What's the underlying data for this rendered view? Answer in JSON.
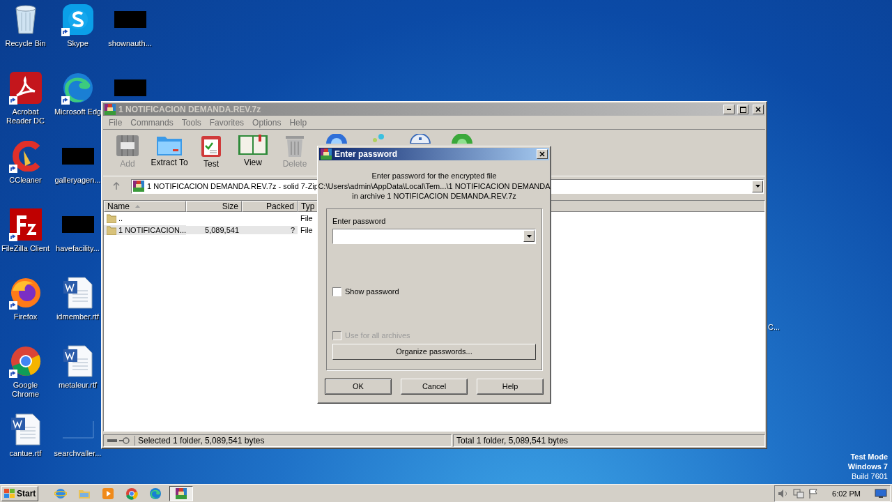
{
  "desktop": {
    "icons": [
      {
        "kind": "recycle",
        "label": "Recycle Bin"
      },
      {
        "kind": "acrobat",
        "label": "Acrobat Reader DC",
        "shortcut": true
      },
      {
        "kind": "ccleaner",
        "label": "CCleaner",
        "shortcut": true
      },
      {
        "kind": "filezilla",
        "label": "FileZilla Client",
        "shortcut": true
      },
      {
        "kind": "firefox",
        "label": "Firefox",
        "shortcut": true
      },
      {
        "kind": "chrome",
        "label": "Google Chrome",
        "shortcut": true
      },
      {
        "kind": "word",
        "label": "cantue.rtf"
      },
      {
        "kind": "skype",
        "label": "Skype",
        "shortcut": true
      },
      {
        "kind": "edge",
        "label": "Microsoft Edg",
        "shortcut": true
      },
      {
        "kind": "redacted",
        "label": "galleryagen..."
      },
      {
        "kind": "redacted",
        "label": "havefacility..."
      },
      {
        "kind": "word",
        "label": "idmember.rtf"
      },
      {
        "kind": "word",
        "label": "metaleur.rtf"
      },
      {
        "kind": "blank",
        "label": "searchvaller..."
      },
      {
        "kind": "redacted",
        "label": "shownauth..."
      },
      {
        "kind": "redacted"
      }
    ],
    "stray_label": "C...",
    "system_text": [
      "Test Mode",
      "Windows 7",
      "Build 7601"
    ]
  },
  "window": {
    "title": "1 NOTIFICACION DEMANDA.REV.7z",
    "menu": [
      "File",
      "Commands",
      "Tools",
      "Favorites",
      "Options",
      "Help"
    ],
    "toolbar": [
      {
        "kind": "add",
        "label": "Add",
        "disabled": true
      },
      {
        "kind": "extract",
        "label": "Extract To",
        "disabled": false
      },
      {
        "kind": "test",
        "label": "Test",
        "disabled": false
      },
      {
        "kind": "view",
        "label": "View",
        "disabled": false
      },
      {
        "kind": "delete",
        "label": "Delete",
        "disabled": true
      },
      {
        "kind": "find"
      },
      {
        "kind": "wizard"
      },
      {
        "kind": "info"
      },
      {
        "kind": "virus"
      }
    ],
    "address": "1 NOTIFICACION DEMANDA.REV.7z - solid 7-Zip",
    "columns": [
      "Name",
      "Size",
      "Packed",
      "Typ"
    ],
    "rows": [
      {
        "name": "..",
        "size": "",
        "packed": "",
        "type": "File",
        "selected": false
      },
      {
        "name": "1 NOTIFICACION...",
        "size": "5,089,541",
        "packed": "?",
        "type": "File",
        "selected": true
      }
    ],
    "status": [
      "Selected 1 folder, 5,089,541 bytes",
      "Total 1 folder, 5,089,541 bytes"
    ]
  },
  "dialog": {
    "title": "Enter password",
    "message": [
      "Enter password for the encrypted file",
      "C:\\Users\\admin\\AppData\\Local\\Tem...\\1 NOTIFICACION DEMANDA",
      "in archive 1 NOTIFICACION DEMANDA.REV.7z"
    ],
    "field_label": "Enter password",
    "checkboxes": [
      {
        "label": "Show password",
        "checked": false,
        "disabled": false
      },
      {
        "label": "Use for all archives",
        "checked": false,
        "disabled": true
      }
    ],
    "organize_button": "Organize passwords...",
    "buttons": [
      {
        "label": "OK",
        "default": true
      },
      {
        "label": "Cancel",
        "default": false
      },
      {
        "label": "Help",
        "default": false
      }
    ]
  },
  "taskbar": {
    "start": "Start",
    "apps": [
      {
        "kind": "ie",
        "selected": false
      },
      {
        "kind": "explorer",
        "selected": false
      },
      {
        "kind": "media",
        "selected": false
      },
      {
        "kind": "chrome",
        "selected": false
      },
      {
        "kind": "edge",
        "selected": false
      },
      {
        "kind": "winrar",
        "selected": true
      }
    ],
    "clock": "6:02 PM"
  }
}
